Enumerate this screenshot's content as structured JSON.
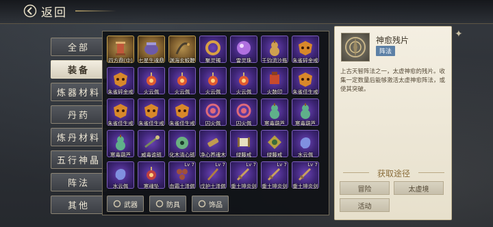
{
  "header": {
    "back_label": "返回"
  },
  "tabs": [
    {
      "label": "全部",
      "active": false
    },
    {
      "label": "装备",
      "active": true
    },
    {
      "label": "炼器材料",
      "active": false
    },
    {
      "label": "丹药",
      "active": false
    },
    {
      "label": "炼丹材料",
      "active": false
    },
    {
      "label": "五行神晶",
      "active": false
    },
    {
      "label": "阵法",
      "active": false
    },
    {
      "label": "其他",
      "active": false
    }
  ],
  "items": [
    {
      "name": "四方鼎(中)",
      "rarity": "gold",
      "icon": "tower-icon",
      "color": "#c0573a"
    },
    {
      "name": "七星生魂鼎",
      "rarity": "gold",
      "icon": "cauldron-icon",
      "color": "#6c5aa8"
    },
    {
      "name": "渊海玄蛟鞭",
      "rarity": "gold",
      "icon": "whip-icon",
      "color": "#4a3f2e"
    },
    {
      "name": "聚灵镯",
      "rarity": "purple",
      "icon": "ring-icon",
      "color": "#d8a044"
    },
    {
      "name": "雷灵珠",
      "rarity": "purple",
      "icon": "orb-icon",
      "color": "#b070e0"
    },
    {
      "name": "千钧流沙瓶",
      "rarity": "purple",
      "icon": "gourd-icon",
      "color": "#d0a050"
    },
    {
      "name": "朱雀碎金戒",
      "rarity": "purple",
      "icon": "mask-icon",
      "color": "#d8882a"
    },
    {
      "name": "朱雀碎金戒",
      "rarity": "purple",
      "icon": "mask-icon",
      "color": "#d8882a"
    },
    {
      "name": "火云佩",
      "rarity": "purple",
      "icon": "pendant-icon",
      "color": "#e05a30"
    },
    {
      "name": "火云佩",
      "rarity": "purple",
      "icon": "pendant-icon",
      "color": "#e05a30"
    },
    {
      "name": "火云佩",
      "rarity": "purple",
      "icon": "pendant-icon",
      "color": "#e05a30"
    },
    {
      "name": "火云佩",
      "rarity": "purple",
      "icon": "pendant-icon",
      "color": "#e05a30"
    },
    {
      "name": "火鼓印",
      "rarity": "purple",
      "icon": "seal-icon",
      "color": "#c84a2c"
    },
    {
      "name": "朱雀佳生戒",
      "rarity": "purple",
      "icon": "mask-icon",
      "color": "#d8882a"
    },
    {
      "name": "朱雀佳生戒",
      "rarity": "purple",
      "icon": "mask-icon",
      "color": "#d8882a"
    },
    {
      "name": "朱雀佳生戒",
      "rarity": "purple",
      "icon": "mask-icon",
      "color": "#d8882a"
    },
    {
      "name": "朱雀佳生戒",
      "rarity": "purple",
      "icon": "mask-icon",
      "color": "#d8882a"
    },
    {
      "name": "囚火佩",
      "rarity": "purple",
      "icon": "swirl-icon",
      "color": "#e06a7a"
    },
    {
      "name": "囚火佩",
      "rarity": "purple",
      "icon": "swirl-icon",
      "color": "#e06a7a"
    },
    {
      "name": "寒毒葫芦",
      "rarity": "purple",
      "icon": "gourd-icon",
      "color": "#5fb08a"
    },
    {
      "name": "寒毒葫芦",
      "rarity": "purple",
      "icon": "gourd-icon",
      "color": "#5fb08a"
    },
    {
      "name": "寒毒葫芦",
      "rarity": "purple",
      "icon": "gourd-icon",
      "color": "#5fb08a"
    },
    {
      "name": "威毒诡链",
      "rarity": "purple",
      "icon": "chain-icon",
      "color": "#7a8a5a"
    },
    {
      "name": "化木清心链",
      "rarity": "purple",
      "icon": "jade-icon",
      "color": "#6ab080"
    },
    {
      "name": "净心养魂木",
      "rarity": "purple",
      "icon": "wood-icon",
      "color": "#c09a50"
    },
    {
      "name": "绿藤戒",
      "rarity": "purple",
      "icon": "scroll-icon",
      "color": "#e8e0c0"
    },
    {
      "name": "绿藤戒",
      "rarity": "purple",
      "icon": "knot-icon",
      "color": "#b8a040"
    },
    {
      "name": "水云佩",
      "rarity": "purple",
      "icon": "blob-icon",
      "color": "#8090e0"
    },
    {
      "name": "水云佩",
      "rarity": "purple",
      "icon": "blob-icon",
      "color": "#8090e0"
    },
    {
      "name": "寒魂坠",
      "rarity": "purple",
      "icon": "pendant-icon",
      "color": "#c04040"
    },
    {
      "name": "血霜土泽佩",
      "rarity": "purple",
      "icon": "bead-icon",
      "color": "#a0503a",
      "lv": "Lv 7"
    },
    {
      "name": "戊护土泽佩",
      "rarity": "purple",
      "icon": "blade-icon",
      "color": "#b08040",
      "lv": "Lv 7"
    },
    {
      "name": "重土坤炎剑",
      "rarity": "purple",
      "icon": "sword-icon",
      "color": "#c8a060",
      "lv": "Lv 7"
    },
    {
      "name": "重土坤炎剑",
      "rarity": "purple",
      "icon": "sword-icon",
      "color": "#c8a060",
      "lv": "Lv 7"
    },
    {
      "name": "重土坤炎剑",
      "rarity": "purple",
      "icon": "sword-icon",
      "color": "#c8a060",
      "lv": "Lv 7"
    }
  ],
  "filters": [
    {
      "label": "武器",
      "icon": "sword-icon"
    },
    {
      "label": "防具",
      "icon": "armor-icon"
    },
    {
      "label": "饰品",
      "icon": "ring-icon"
    }
  ],
  "detail": {
    "name": "神愈残片",
    "tag": "阵法",
    "description": "上古天智阵法之一，太虚神愈的残片。收集一定数量后能够激活太虚神愈阵法，或使其突破。",
    "acquire_title": "获取途径",
    "acquire_buttons": [
      "冒险",
      "太虚境",
      "活动"
    ]
  }
}
